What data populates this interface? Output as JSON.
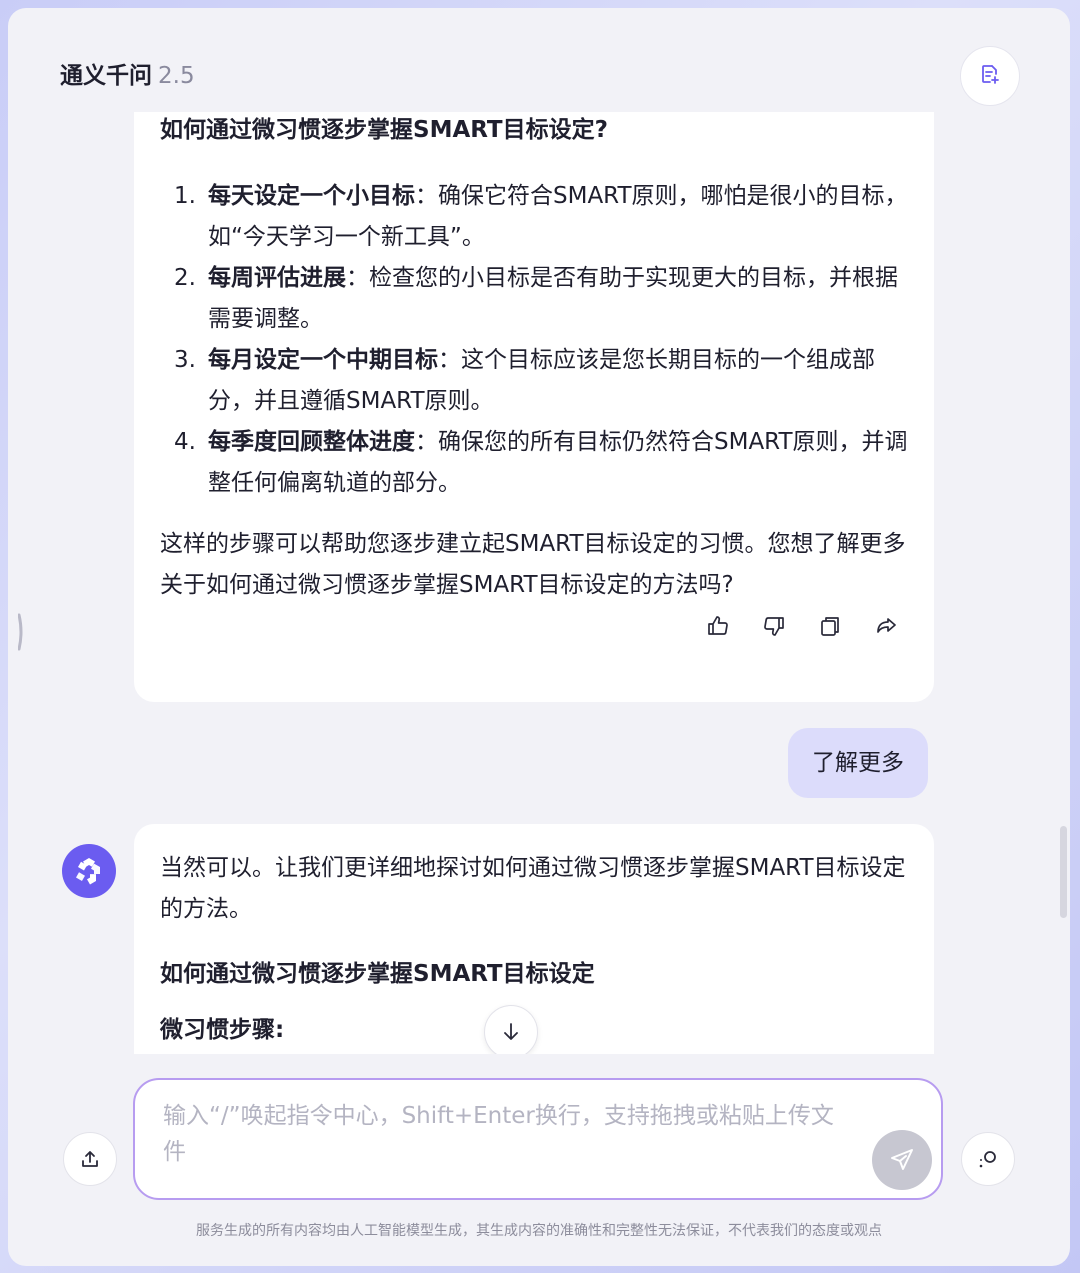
{
  "app": {
    "title": "通义千问",
    "version": "2.5"
  },
  "conversation": {
    "ai_message_1": {
      "heading": "如何通过微习惯逐步掌握SMART目标设定?",
      "steps": [
        {
          "num": "1.",
          "bold": "每天设定一个小目标",
          "text": "：确保它符合SMART原则，哪怕是很小的目标，如“今天学习一个新工具”。"
        },
        {
          "num": "2.",
          "bold": "每周评估进展",
          "text": "：检查您的小目标是否有助于实现更大的目标，并根据需要调整。"
        },
        {
          "num": "3.",
          "bold": "每月设定一个中期目标",
          "text": "：这个目标应该是您长期目标的一个组成部分，并且遵循SMART原则。"
        },
        {
          "num": "4.",
          "bold": "每季度回顾整体进度",
          "text": "：确保您的所有目标仍然符合SMART原则，并调整任何偏离轨道的部分。"
        }
      ],
      "closing": "这样的步骤可以帮助您逐步建立起SMART目标设定的习惯。您想了解更多关于如何通过微习惯逐步掌握SMART目标设定的方法吗?",
      "actions": [
        "thumbs-up-icon",
        "thumbs-down-icon",
        "copy-icon",
        "share-icon"
      ]
    },
    "user_message": "了解更多",
    "ai_message_2": {
      "intro": "当然可以。让我们更详细地探讨如何通过微习惯逐步掌握SMART目标设定的方法。",
      "heading": "如何通过微习惯逐步掌握SMART目标设定",
      "subheading": "微习惯步骤:"
    }
  },
  "input": {
    "placeholder": "输入“/”唤起指令中心，Shift+Enter换行，支持拖拽或粘贴上传文件",
    "value": ""
  },
  "disclaimer": "服务生成的所有内容均由人工智能模型生成，其生成内容的准确性和完整性无法保证，不代表我们的态度或观点",
  "colors": {
    "accent": "#6b5cf0",
    "user_bubble": "#dcdcfb",
    "input_border": "#b79cf0"
  }
}
